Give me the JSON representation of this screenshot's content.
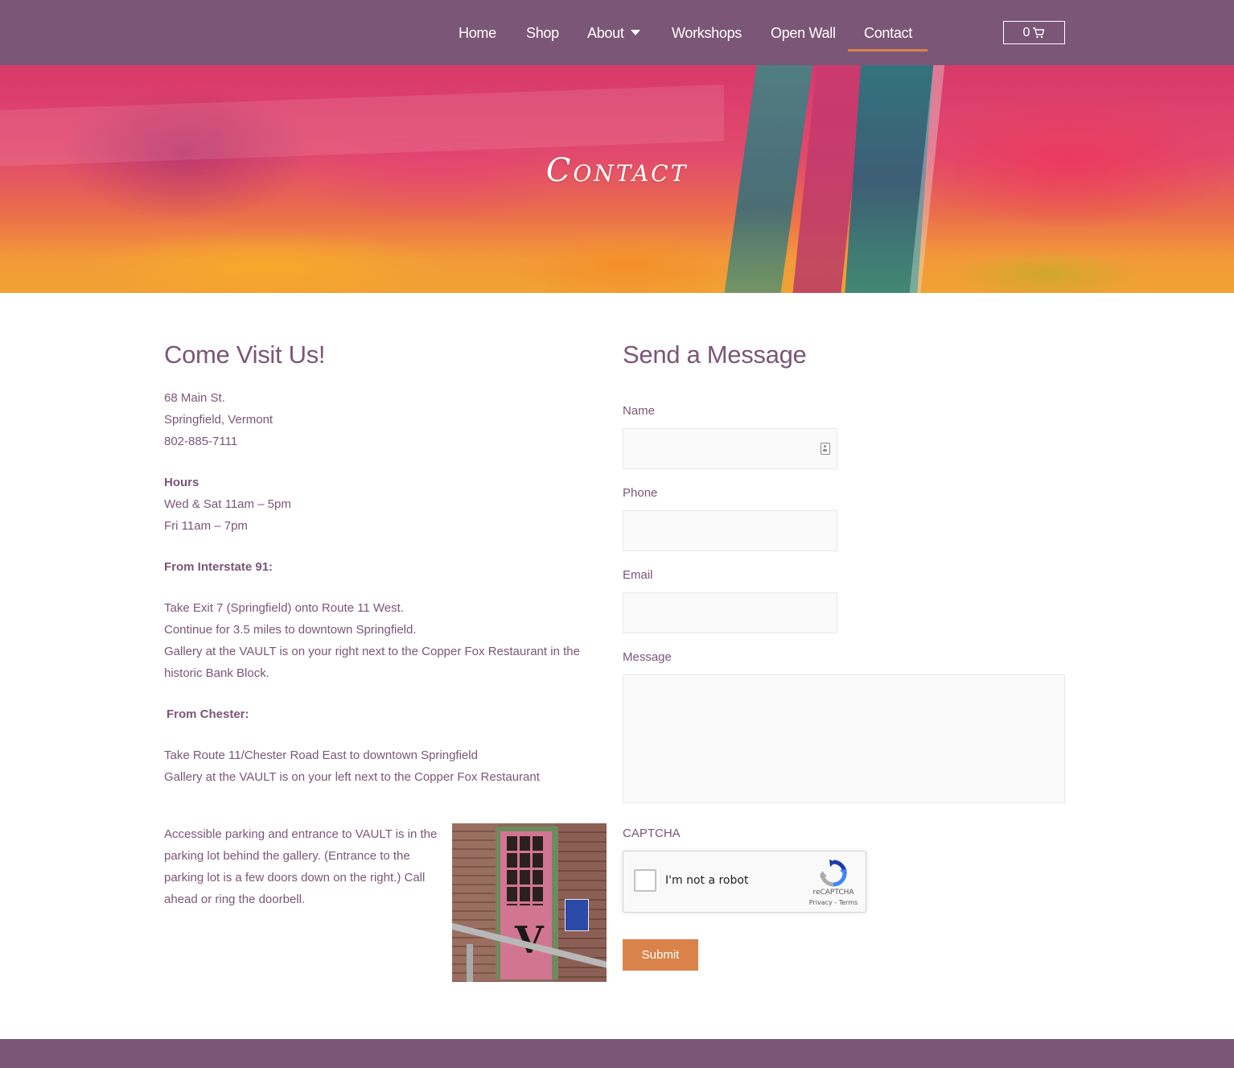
{
  "nav": {
    "items": [
      {
        "label": "Home"
      },
      {
        "label": "Shop"
      },
      {
        "label": "About"
      },
      {
        "label": "Workshops"
      },
      {
        "label": "Open Wall"
      },
      {
        "label": "Contact"
      }
    ],
    "active": "Contact",
    "cart_count": "0"
  },
  "hero": {
    "title": "Contact"
  },
  "visit": {
    "heading": "Come Visit Us!",
    "address_line1": "68 Main St.",
    "address_line2": "Springfield, Vermont",
    "phone": "802-885-7111",
    "hours_heading": "Hours",
    "hours_line1": "Wed & Sat 11am – 5pm",
    "hours_line2": "Fri 11am – 7pm",
    "i91_heading": "From Interstate 91:",
    "i91_line1": "Take Exit 7 (Springfield) onto Route 11 West.",
    "i91_line2": "Continue for 3.5 miles to downtown Springfield.",
    "i91_line3": "Gallery at the VAULT is on your right next to the Copper Fox Restaurant in the",
    "i91_line4": "historic Bank Block.",
    "chester_heading": "From Chester:",
    "chester_line1": "Take Route 11/Chester Road East to downtown Springfield",
    "chester_line2": "Gallery at the VAULT is on your left next to the Copper Fox Restaurant",
    "parking_line1": "Accessible parking and entrance to VAULT is in the",
    "parking_line2": "parking lot behind the gallery. (Entrance to the",
    "parking_line3": "parking lot is a few doors down on the right.) Call",
    "parking_line4": "ahead or ring the doorbell."
  },
  "form": {
    "heading": "Send a Message",
    "name_label": "Name",
    "name_value": "",
    "phone_label": "Phone",
    "phone_value": "",
    "email_label": "Email",
    "email_value": "",
    "message_label": "Message",
    "message_value": "",
    "captcha_label": "CAPTCHA",
    "captcha_text": "I'm not a robot",
    "captcha_brand": "reCAPTCHA",
    "captcha_links": "Privacy - Terms",
    "submit_label": "Submit"
  },
  "colors": {
    "brand_purple": "#7b5676",
    "accent_orange": "#d9834a"
  }
}
